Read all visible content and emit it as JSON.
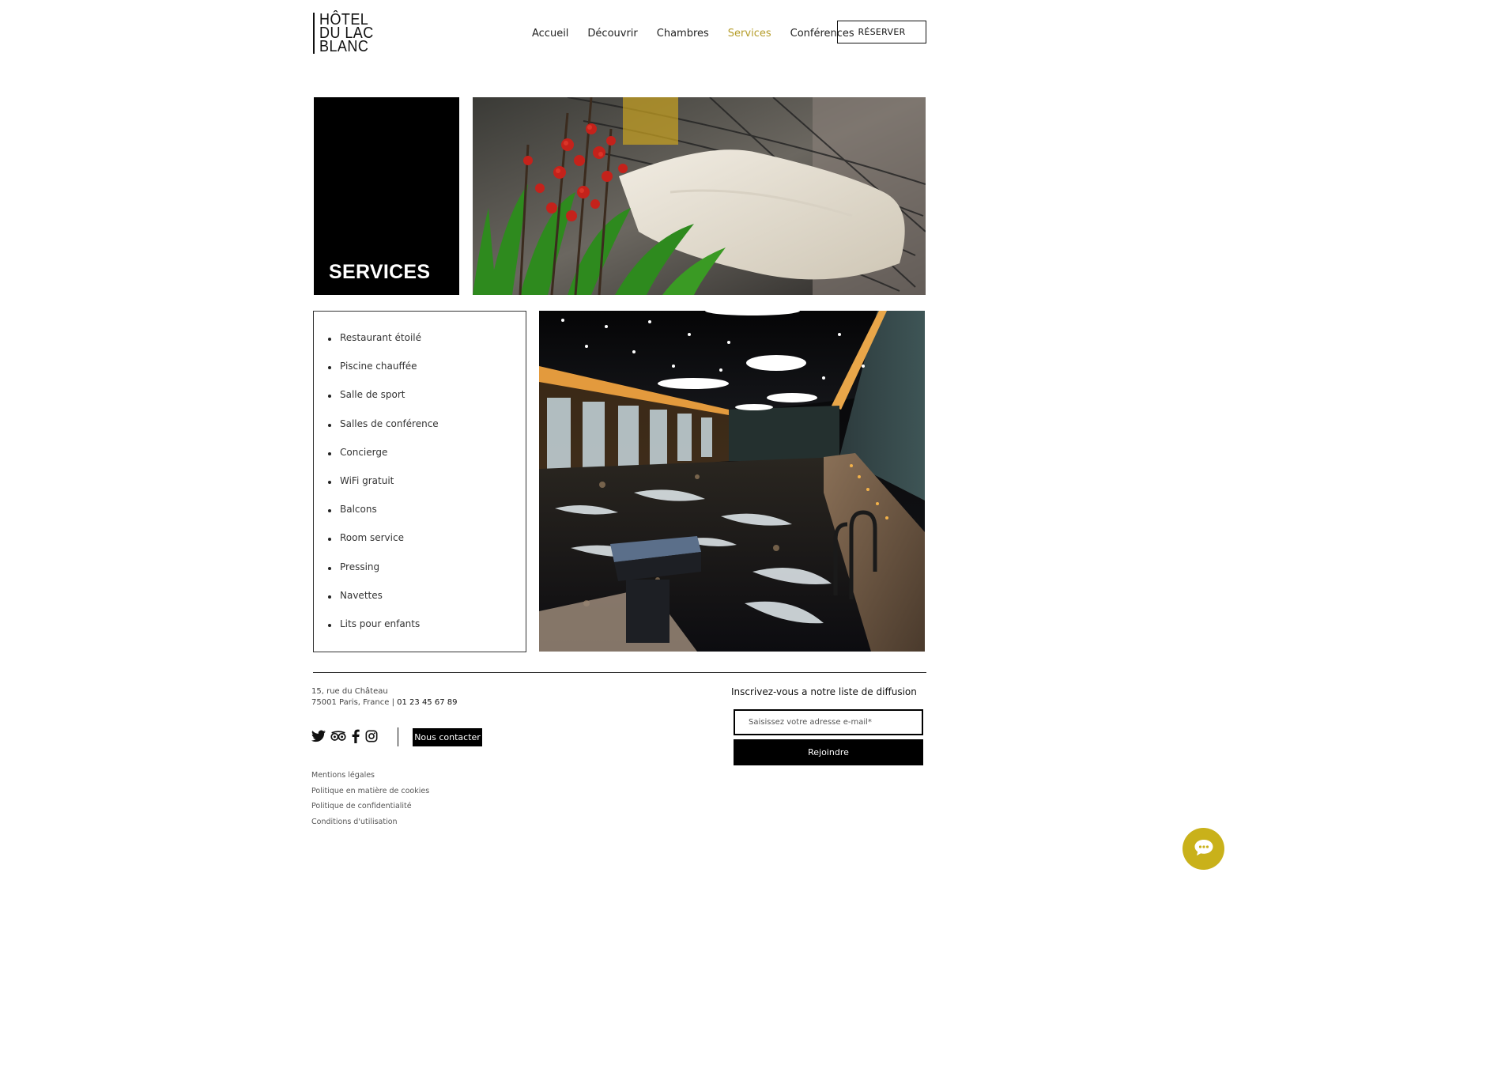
{
  "header": {
    "logo_lines": [
      "HÔTEL",
      "DU LAC",
      "BLANC"
    ],
    "nav": [
      {
        "label": "Accueil",
        "active": false
      },
      {
        "label": "Découvrir",
        "active": false
      },
      {
        "label": "Chambres",
        "active": false
      },
      {
        "label": "Services",
        "active": true
      },
      {
        "label": "Conférences",
        "active": false
      }
    ],
    "reserve_label": "RÉSERVER",
    "accent_color": "#b59d2a"
  },
  "hero": {
    "title": "SERVICES"
  },
  "services": [
    "Restaurant étoilé",
    "Piscine chauffée",
    "Salle de sport",
    "Salles de conférence",
    "Concierge",
    "WiFi gratuit",
    "Balcons",
    "Room service",
    "Pressing",
    "Navettes",
    "Lits pour enfants"
  ],
  "footer": {
    "address_line1": "15, rue du Château",
    "address_line2": "75001 Paris, France | ",
    "phone": "01 23 45 67 89",
    "social_icons": [
      "twitter-icon",
      "tripadvisor-icon",
      "facebook-icon",
      "instagram-icon"
    ],
    "contact_label": "Nous contacter",
    "legal_links": [
      "Mentions légales",
      "Politique en matière de cookies",
      "Politique de confidentialité",
      "Conditions d'utilisation"
    ],
    "newsletter_title": "Inscrivez-vous a notre liste de diffusion",
    "email_placeholder": "Saisissez votre adresse e-mail*",
    "join_label": "Rejoindre"
  },
  "chat": {
    "icon": "chat-icon",
    "color": "#c9b11a"
  }
}
